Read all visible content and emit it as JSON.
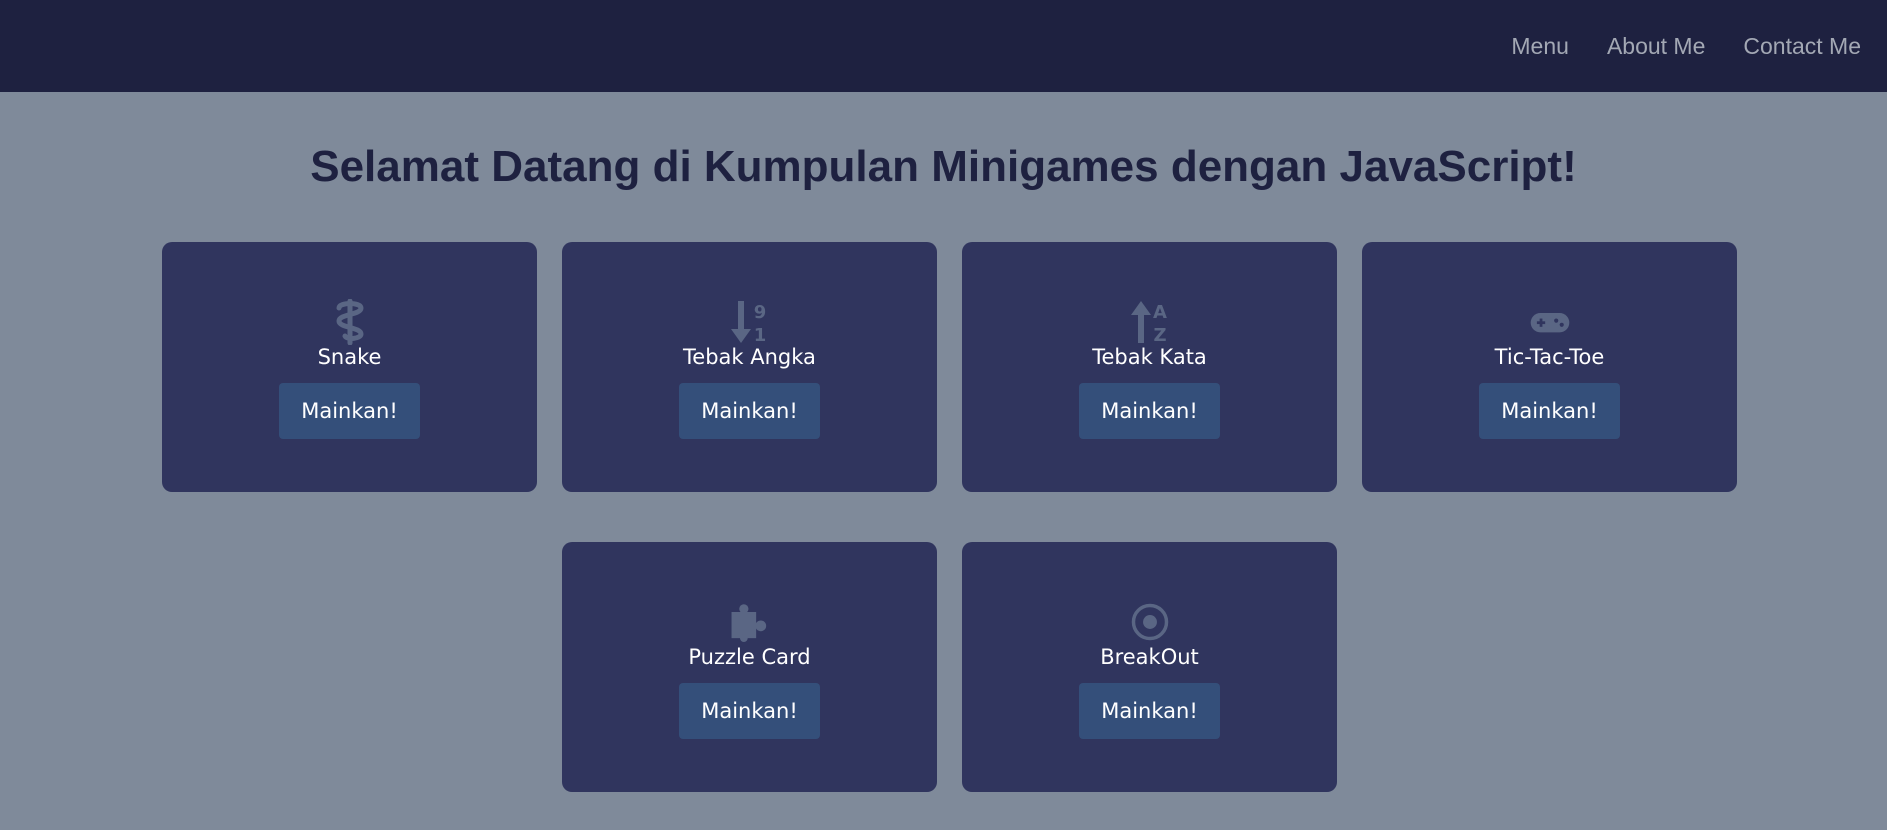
{
  "nav": {
    "links": [
      "Menu",
      "About Me",
      "Contact Me"
    ]
  },
  "page": {
    "title": "Selamat Datang di Kumpulan Minigames dengan JavaScript!"
  },
  "games": [
    {
      "name": "Snake",
      "icon": "staff-snake-icon",
      "button": "Mainkan!"
    },
    {
      "name": "Tebak Angka",
      "icon": "sort-numeric-down-icon",
      "button": "Mainkan!"
    },
    {
      "name": "Tebak Kata",
      "icon": "sort-alpha-up-icon",
      "button": "Mainkan!"
    },
    {
      "name": "Tic-Tac-Toe",
      "icon": "gamepad-icon",
      "button": "Mainkan!"
    },
    {
      "name": "Puzzle Card",
      "icon": "puzzle-piece-icon",
      "button": "Mainkan!"
    },
    {
      "name": "BreakOut",
      "icon": "dot-circle-icon",
      "button": "Mainkan!"
    }
  ],
  "colors": {
    "navbar": "#1e2140",
    "background": "#7f8a9a",
    "card": "#30355e",
    "button": "#344f7a",
    "icon": "#5a6684",
    "title": "#1e2140"
  }
}
